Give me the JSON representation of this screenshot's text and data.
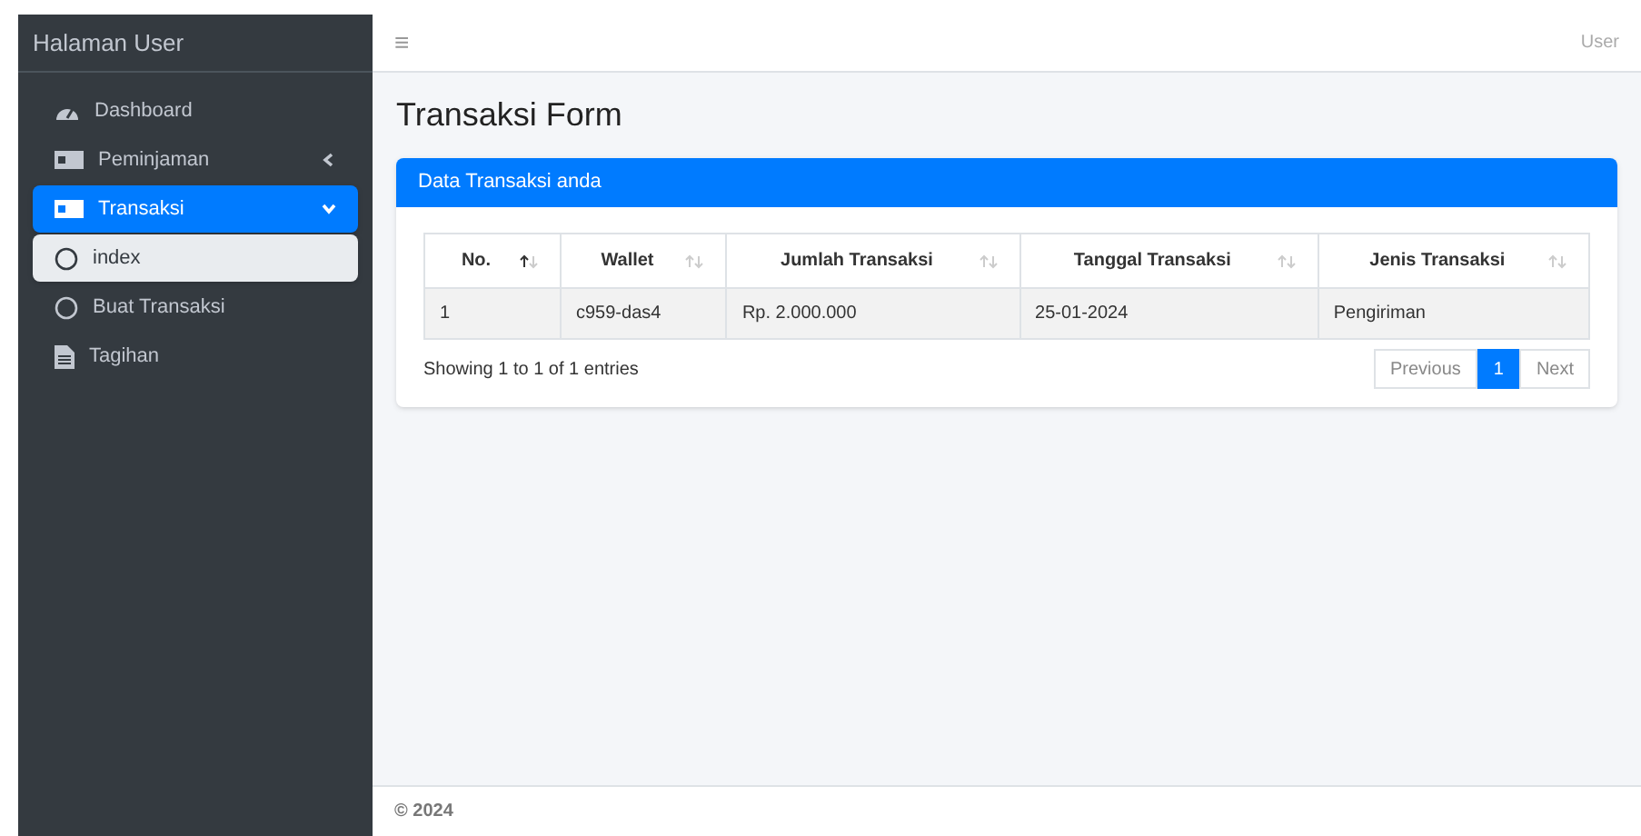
{
  "sidebar": {
    "brand": "Halaman User",
    "items": [
      {
        "label": "Dashboard",
        "kind": "gauge",
        "selected": false
      },
      {
        "label": "Peminjaman",
        "kind": "money",
        "selected": false,
        "expanded": false
      },
      {
        "label": "Transaksi",
        "kind": "money",
        "selected": true,
        "expanded": true,
        "children": [
          {
            "label": "index",
            "kind": "circle",
            "selected": true
          },
          {
            "label": "Buat Transaksi",
            "kind": "circle",
            "selected": false
          }
        ]
      },
      {
        "label": "Tagihan",
        "kind": "file",
        "selected": false
      }
    ]
  },
  "navbar": {
    "menu_icon": "≡",
    "user": "User"
  },
  "page_title": "Transaksi Form",
  "card": {
    "title": "Data Transaksi anda",
    "table": {
      "columns": [
        {
          "label": "No.",
          "sorted": true
        },
        {
          "label": "Wallet",
          "sorted": false
        },
        {
          "label": "Jumlah Transaksi",
          "sorted": false
        },
        {
          "label": "Tanggal Transaksi",
          "sorted": false
        },
        {
          "label": "Jenis Transaksi",
          "sorted": false
        }
      ],
      "rows": [
        [
          "1",
          "c959-das4",
          "Rp. 2.000.000",
          "25-01-2024",
          "Pengiriman"
        ]
      ]
    },
    "info": "Showing 1 to 1 of 1 entries",
    "pagination": [
      {
        "label": "Previous",
        "selected": false
      },
      {
        "label": "1",
        "selected": true
      },
      {
        "label": "Next",
        "selected": false
      }
    ]
  },
  "footer": "© 2024"
}
